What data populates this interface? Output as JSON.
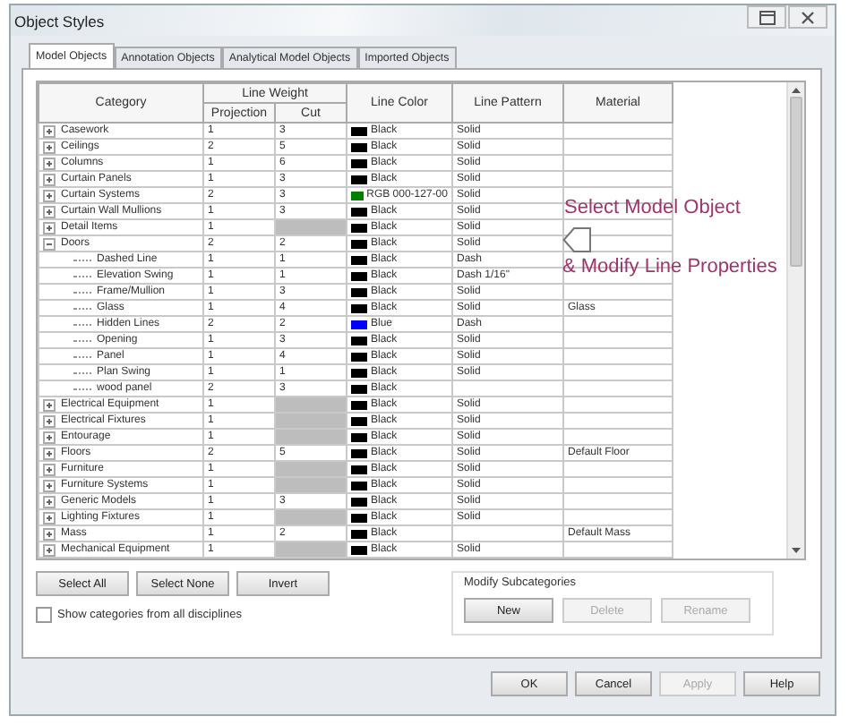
{
  "window": {
    "title": "Object Styles"
  },
  "tabs": [
    {
      "label": "Model Objects",
      "selected": true
    },
    {
      "label": "Annotation Objects",
      "selected": false
    },
    {
      "label": "Analytical Model Objects",
      "selected": false
    },
    {
      "label": "Imported Objects",
      "selected": false
    }
  ],
  "table": {
    "columns": {
      "category": "Category",
      "line_weight": "Line Weight",
      "projection": "Projection",
      "cut": "Cut",
      "line_color": "Line Color",
      "line_pattern": "Line Pattern",
      "material": "Material"
    },
    "rows": [
      {
        "category": "Casework",
        "expanded": false,
        "projection": "1",
        "cut": "3",
        "color_name": "Black",
        "color": "#000000",
        "pattern": "Solid"
      },
      {
        "category": "Ceilings",
        "expanded": false,
        "projection": "2",
        "cut": "5",
        "color_name": "Black",
        "color": "#000000",
        "pattern": "Solid"
      },
      {
        "category": "Columns",
        "expanded": false,
        "projection": "1",
        "cut": "6",
        "color_name": "Black",
        "color": "#000000",
        "pattern": "Solid"
      },
      {
        "category": "Curtain Panels",
        "expanded": false,
        "projection": "1",
        "cut": "3",
        "color_name": "Black",
        "color": "#000000",
        "pattern": "Solid"
      },
      {
        "category": "Curtain Systems",
        "expanded": false,
        "projection": "2",
        "cut": "3",
        "color_name": "RGB 000-127-00",
        "color": "#007f00",
        "pattern": "Solid"
      },
      {
        "category": "Curtain Wall Mullions",
        "expanded": false,
        "projection": "1",
        "cut": "3",
        "color_name": "Black",
        "color": "#000000",
        "pattern": "Solid"
      },
      {
        "category": "Detail Items",
        "expanded": false,
        "projection": "1",
        "color_name": "Black",
        "color": "#000000",
        "pattern": "Solid"
      },
      {
        "category": "Doors",
        "expanded": true,
        "projection": "2",
        "cut": "2",
        "color_name": "Black",
        "color": "#000000",
        "pattern": "Solid",
        "children": [
          {
            "category": "Dashed Line",
            "projection": "1",
            "cut": "1",
            "color_name": "Black",
            "color": "#000000",
            "pattern": "Dash"
          },
          {
            "category": "Elevation Swing",
            "projection": "1",
            "cut": "1",
            "color_name": "Black",
            "color": "#000000",
            "pattern": "Dash 1/16\""
          },
          {
            "category": "Frame/Mullion",
            "projection": "1",
            "cut": "3",
            "color_name": "Black",
            "color": "#000000",
            "pattern": "Solid"
          },
          {
            "category": "Glass",
            "projection": "1",
            "cut": "4",
            "color_name": "Black",
            "color": "#000000",
            "pattern": "Solid",
            "material": "Glass"
          },
          {
            "category": "Hidden Lines",
            "projection": "2",
            "cut": "2",
            "color_name": "Blue",
            "color": "#0000ff",
            "pattern": "Dash"
          },
          {
            "category": "Opening",
            "projection": "1",
            "cut": "3",
            "color_name": "Black",
            "color": "#000000",
            "pattern": "Solid"
          },
          {
            "category": "Panel",
            "projection": "1",
            "cut": "4",
            "color_name": "Black",
            "color": "#000000",
            "pattern": "Solid"
          },
          {
            "category": "Plan Swing",
            "projection": "1",
            "cut": "1",
            "color_name": "Black",
            "color": "#000000",
            "pattern": "Solid"
          },
          {
            "category": "wood panel",
            "projection": "2",
            "cut": "3",
            "color_name": "Black",
            "color": "#000000"
          }
        ]
      },
      {
        "category": "Electrical Equipment",
        "expanded": false,
        "projection": "1",
        "color_name": "Black",
        "color": "#000000",
        "pattern": "Solid"
      },
      {
        "category": "Electrical Fixtures",
        "expanded": false,
        "projection": "1",
        "color_name": "Black",
        "color": "#000000",
        "pattern": "Solid"
      },
      {
        "category": "Entourage",
        "expanded": false,
        "projection": "1",
        "color_name": "Black",
        "color": "#000000",
        "pattern": "Solid"
      },
      {
        "category": "Floors",
        "expanded": false,
        "projection": "2",
        "cut": "5",
        "color_name": "Black",
        "color": "#000000",
        "pattern": "Solid",
        "material": "Default Floor"
      },
      {
        "category": "Furniture",
        "expanded": false,
        "projection": "1",
        "color_name": "Black",
        "color": "#000000",
        "pattern": "Solid"
      },
      {
        "category": "Furniture Systems",
        "expanded": false,
        "projection": "1",
        "color_name": "Black",
        "color": "#000000",
        "pattern": "Solid"
      },
      {
        "category": "Generic Models",
        "expanded": false,
        "projection": "1",
        "cut": "3",
        "color_name": "Black",
        "color": "#000000",
        "pattern": "Solid"
      },
      {
        "category": "Lighting Fixtures",
        "expanded": false,
        "projection": "1",
        "color_name": "Black",
        "color": "#000000",
        "pattern": "Solid"
      },
      {
        "category": "Mass",
        "expanded": false,
        "projection": "1",
        "cut": "2",
        "color_name": "Black",
        "color": "#000000",
        "material": "Default Mass"
      },
      {
        "category": "Mechanical Equipment",
        "expanded": false,
        "projection": "1",
        "color_name": "Black",
        "color": "#000000",
        "pattern": "Solid"
      }
    ]
  },
  "annotation": [
    "Select  Model Object",
    "& Modify Line  Properties"
  ],
  "selection_buttons": [
    {
      "label": "Select All",
      "disabled": false
    },
    {
      "label": "Select None",
      "disabled": false
    },
    {
      "label": "Invert",
      "disabled": false
    }
  ],
  "show_all_disciplines": {
    "label": "Show categories from all disciplines",
    "checked": false
  },
  "modify_subcategories": {
    "title": "Modify Subcategories",
    "buttons": [
      {
        "label": "New",
        "disabled": false
      },
      {
        "label": "Delete",
        "disabled": true
      },
      {
        "label": "Rename",
        "disabled": true
      }
    ]
  },
  "footer_buttons": [
    {
      "label": "OK",
      "disabled": false
    },
    {
      "label": "Cancel",
      "disabled": false
    },
    {
      "label": "Apply",
      "disabled": true
    },
    {
      "label": "Help",
      "disabled": false
    }
  ]
}
